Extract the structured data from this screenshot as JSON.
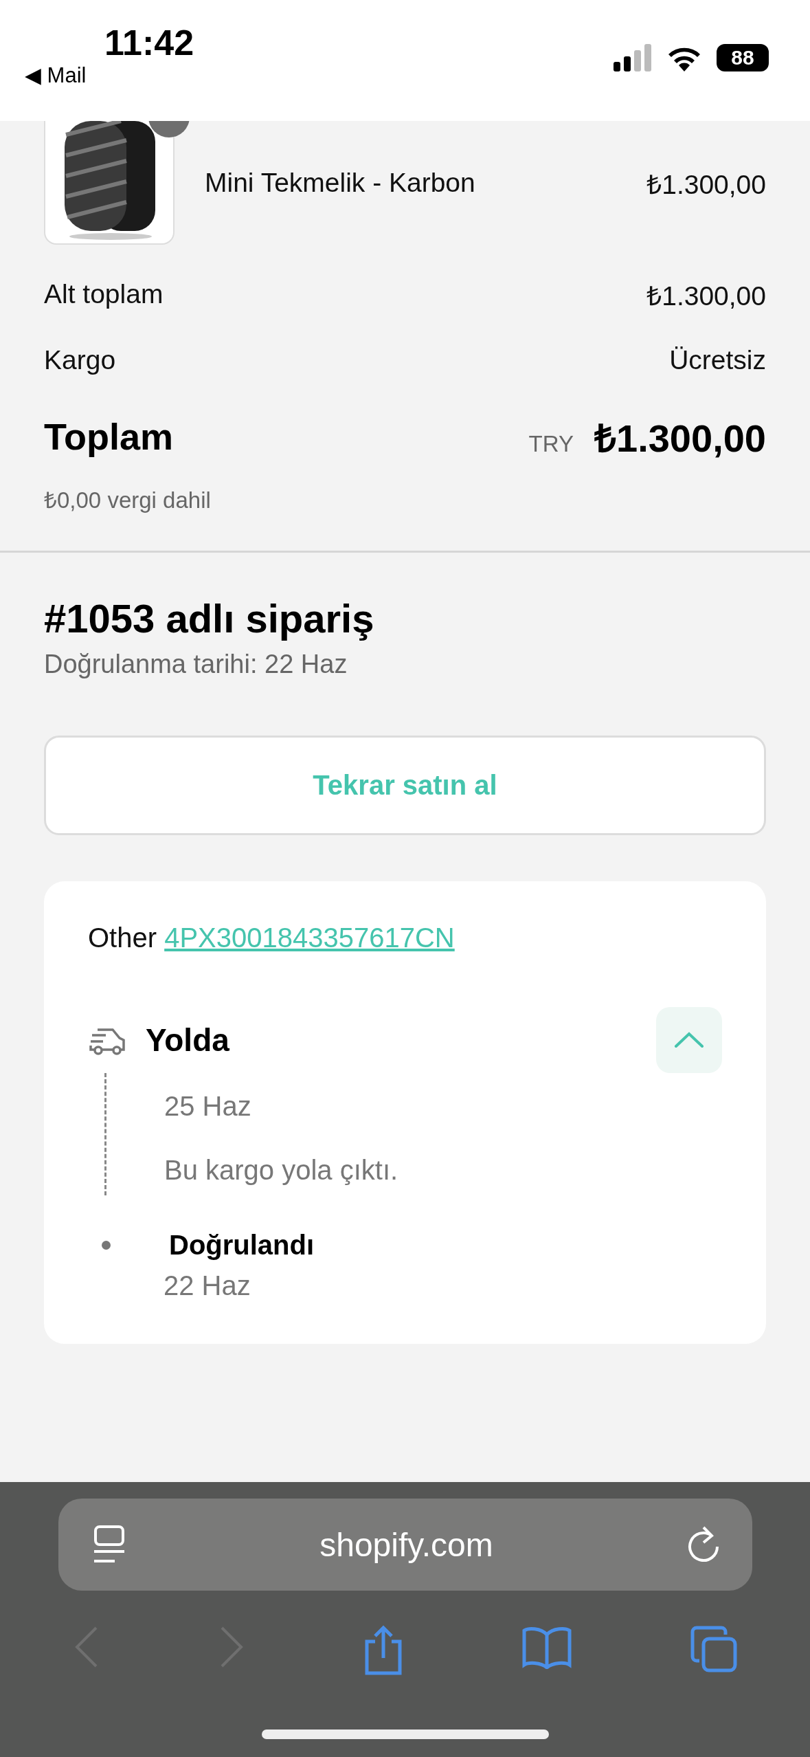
{
  "status_bar": {
    "time": "11:42",
    "back_label": "◀ Mail",
    "battery": "88"
  },
  "product": {
    "name": "Mini Tekmelik - Karbon",
    "price": "₺1.300,00"
  },
  "summary": [
    {
      "label": "Alt toplam",
      "value": "₺1.300,00"
    },
    {
      "label": "Kargo",
      "value": "Ücretsiz"
    }
  ],
  "total": {
    "label": "Toplam",
    "currency": "TRY",
    "value": "₺1.300,00",
    "tax_note": "₺0,00 vergi dahil"
  },
  "order": {
    "title": "#1053 adlı sipariş",
    "subtitle": "Doğrulanma tarihi: 22 Haz"
  },
  "buy_again_button": "Tekrar satın al",
  "tracking": {
    "carrier": "Other",
    "number": "4PX3001843357617CN",
    "expanded": true,
    "events": [
      {
        "kind": "current",
        "title": "Yolda",
        "date": "25 Haz",
        "detail": "Bu kargo yola çıktı."
      },
      {
        "kind": "past",
        "title": "Doğrulandı",
        "date": "22 Haz"
      }
    ]
  },
  "browser": {
    "url": "shopify.com"
  }
}
